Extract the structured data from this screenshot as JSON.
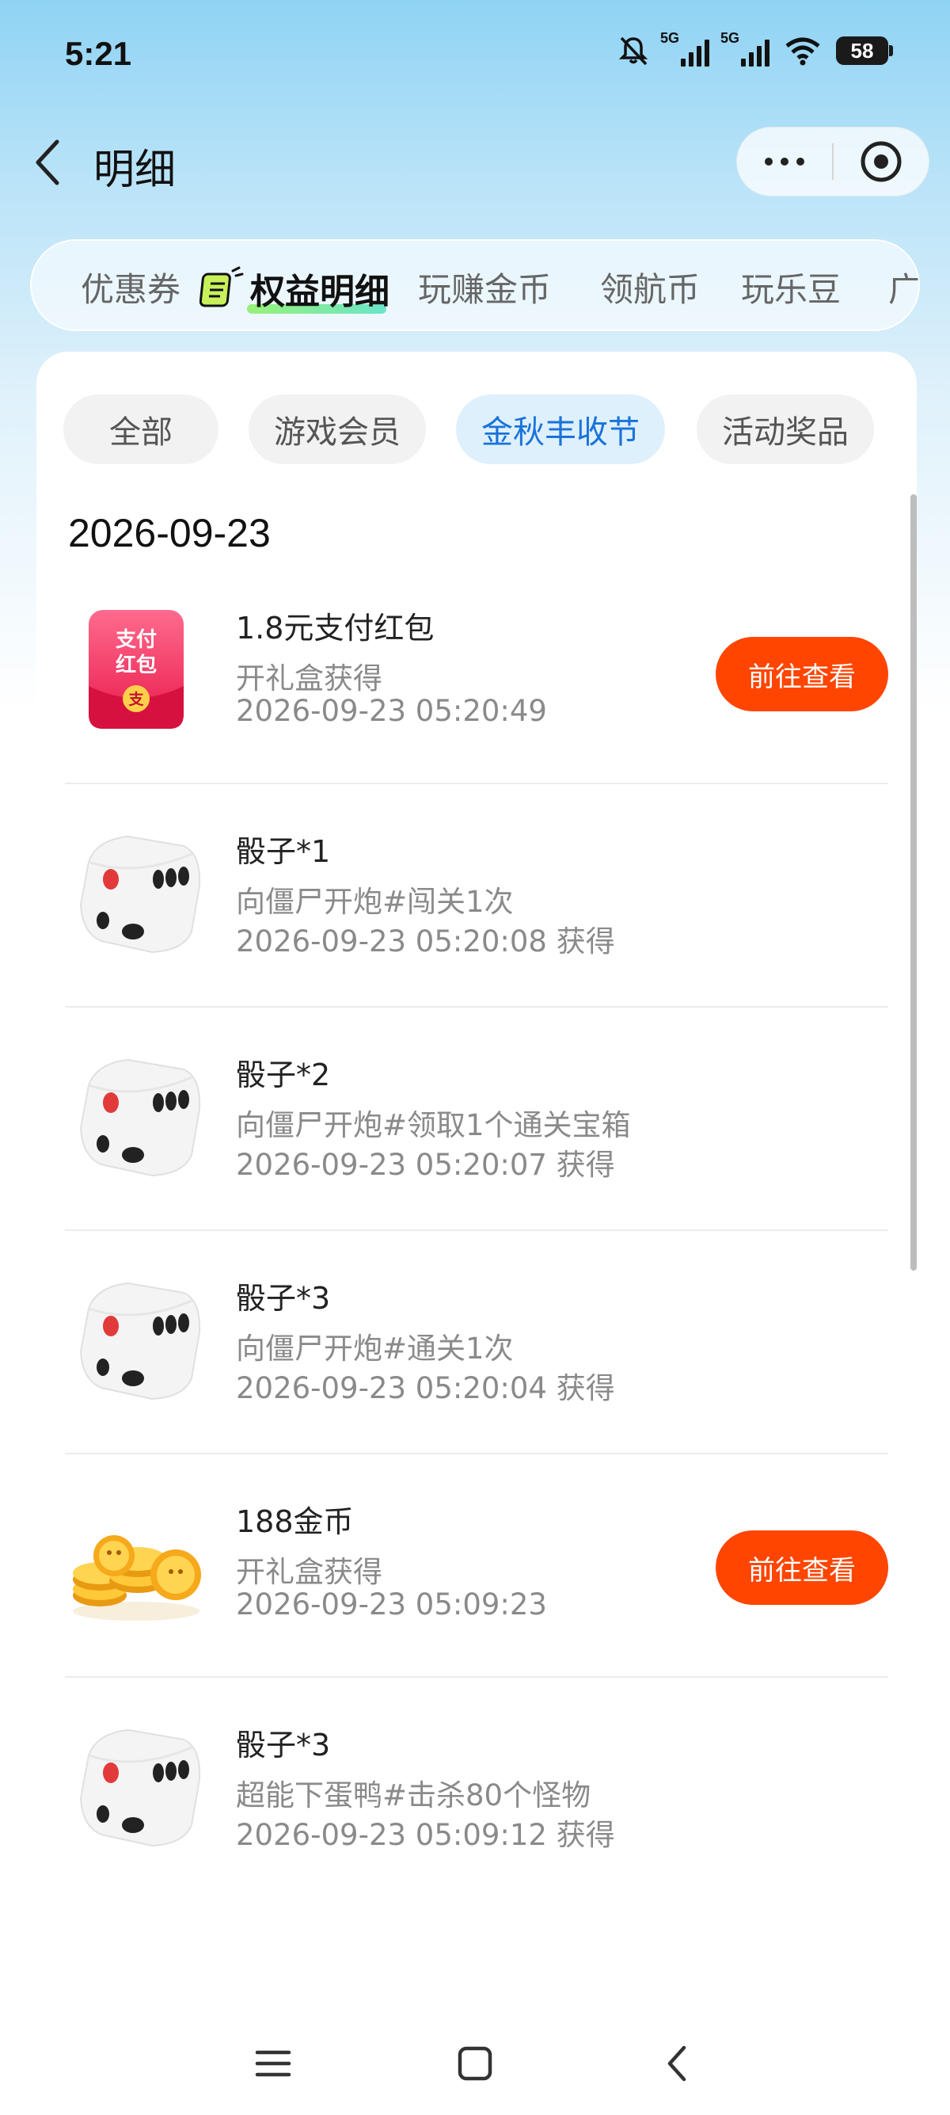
{
  "status_bar": {
    "time": "5:21",
    "network_1": "5G",
    "network_2": "5G",
    "battery": "58",
    "icons": [
      "mute-icon",
      "signal-icon",
      "signal-icon",
      "wifi-icon",
      "battery-icon"
    ]
  },
  "header": {
    "title": "明细",
    "icons": [
      "back-icon",
      "more-icon",
      "target-icon"
    ]
  },
  "category_tabs": {
    "items": [
      "优惠券",
      "权益明细",
      "玩赚金币",
      "领航币",
      "玩乐豆",
      "广"
    ],
    "active": "权益明细"
  },
  "filters": {
    "items": [
      "全部",
      "游戏会员",
      "金秋丰收节",
      "活动奖品"
    ],
    "active": "金秋丰收节"
  },
  "date_header": "2026-09-23",
  "records": [
    {
      "icon": "red-envelope-icon",
      "title": "1.8元支付红包",
      "subtitle": "开礼盒获得",
      "time": "2026-09-23 05:20:49",
      "button": "前往查看",
      "envelope_text": "支付\n红包",
      "seal": "支"
    },
    {
      "icon": "dice-icon",
      "title": "骰子*1",
      "subtitle": "向僵尸开炮#闯关1次",
      "time": "2026-09-23 05:20:08 获得",
      "button": ""
    },
    {
      "icon": "dice-icon",
      "title": "骰子*2",
      "subtitle": "向僵尸开炮#领取1个通关宝箱",
      "time": "2026-09-23 05:20:07 获得",
      "button": ""
    },
    {
      "icon": "dice-icon",
      "title": "骰子*3",
      "subtitle": "向僵尸开炮#通关1次",
      "time": "2026-09-23 05:20:04 获得",
      "button": ""
    },
    {
      "icon": "gold-coins-icon",
      "title": "188金币",
      "subtitle": "开礼盒获得",
      "time": "2026-09-23 05:09:23",
      "button": "前往查看"
    },
    {
      "icon": "dice-icon",
      "title": "骰子*3",
      "subtitle": "超能下蛋鸭#击杀80个怪物",
      "time": "2026-09-23 05:09:12 获得",
      "button": ""
    }
  ],
  "system_nav": {
    "icons": [
      "menu-icon",
      "home-icon",
      "back-icon"
    ]
  },
  "colors": {
    "accent_orange": "#ff4500",
    "active_filter_text": "#1a73d9",
    "active_filter_bg": "#dff0fd"
  }
}
